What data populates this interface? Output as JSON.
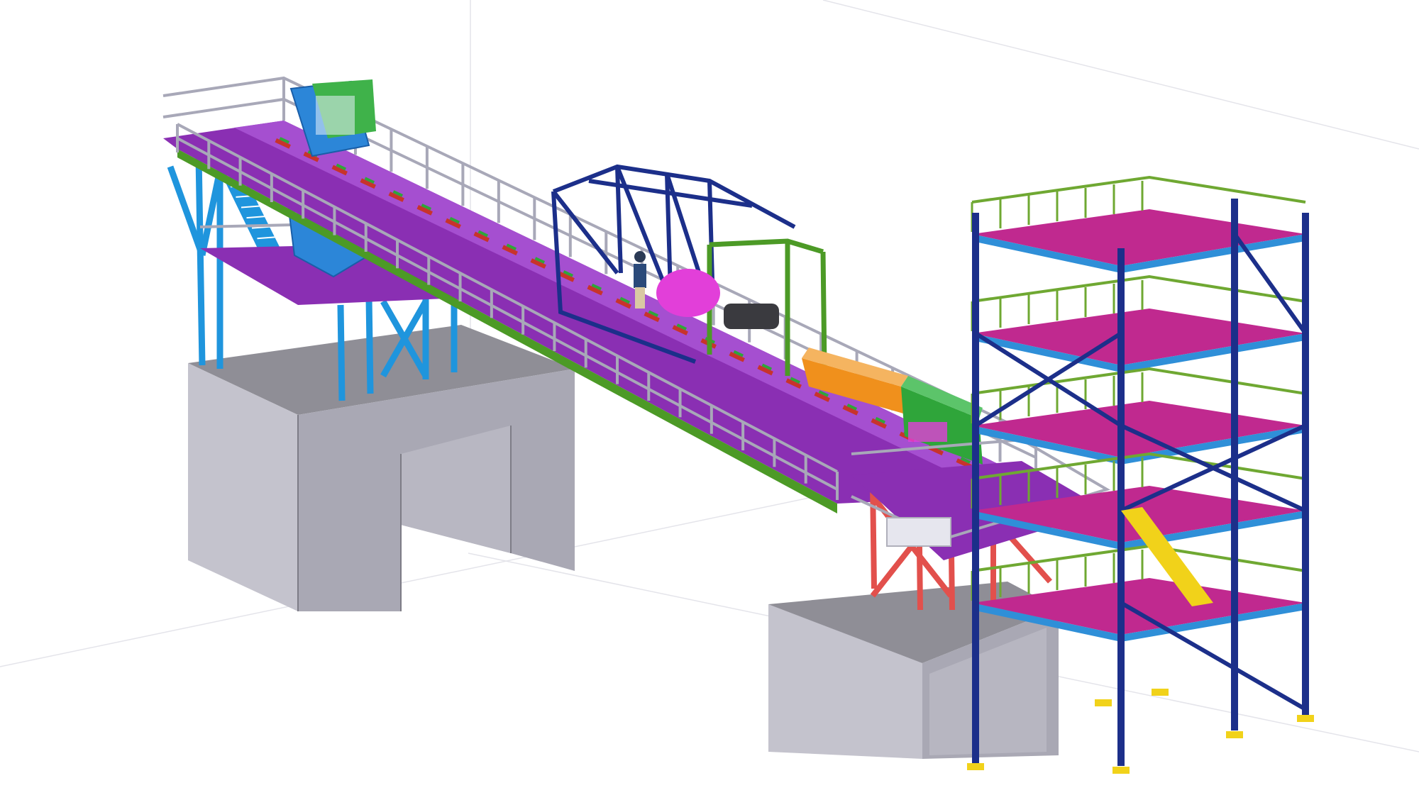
{
  "colors": {
    "background": "#ffffff",
    "concrete_front": "#a9a8b4",
    "concrete_side": "#c4c3cd",
    "concrete_top": "#8f8e96",
    "deck": "#8a2fb3",
    "deck_light": "#a54fd0",
    "tower_deck": "#c0298f",
    "tower_deck_edge": "#2f8fd8",
    "handrail": "#a8a8b8",
    "tower_handrail": "#6fa832",
    "green_frame": "#4c9a26",
    "blue_column": "#1f95dd",
    "navy_steel": "#1c2f8a",
    "red_support": "#e2504c",
    "orange_box": "#f0901c",
    "green_box": "#2fa53a",
    "magenta_drum": "#e23fd9",
    "idler": "#c8332b",
    "hopper": "#2c86d8",
    "footplate": "#f1d21a",
    "dark_drum": "#3a3a3f"
  },
  "icons": {
    "person": "worker-figure",
    "hopper": "feed-hopper",
    "drive": "drive-unit",
    "drum": "magnetic-drum"
  }
}
